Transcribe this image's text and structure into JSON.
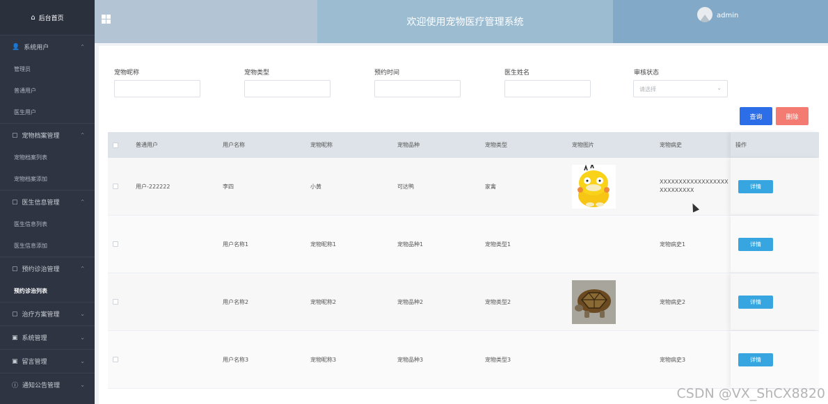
{
  "sidebar": {
    "home": "后台首页",
    "groups": [
      {
        "label": "系统用户",
        "items": [
          "管理员",
          "普通用户",
          "医生用户"
        ]
      },
      {
        "label": "宠物档案管理",
        "items": [
          "宠物档案列表",
          "宠物档案添加"
        ]
      },
      {
        "label": "医生信息管理",
        "items": [
          "医生信息列表",
          "医生信息添加"
        ]
      },
      {
        "label": "预约诊治管理",
        "items": [
          "预约诊治列表"
        ]
      },
      {
        "label": "治疗方案管理",
        "items": []
      },
      {
        "label": "系统管理",
        "items": []
      },
      {
        "label": "留言管理",
        "items": []
      },
      {
        "label": "通知公告管理",
        "items": []
      }
    ]
  },
  "header": {
    "title": "欢迎使用宠物医疗管理系统",
    "user": "admin"
  },
  "filters": {
    "pet_nickname": "宠物昵称",
    "pet_type": "宠物类型",
    "appointment_time": "预约时间",
    "doctor_name": "医生姓名",
    "review_status": "审核状态",
    "review_placeholder": "请选择"
  },
  "buttons": {
    "query": "查询",
    "delete": "删除"
  },
  "table": {
    "headers": [
      "普通用户",
      "用户名称",
      "宠物昵称",
      "宠物品种",
      "宠物类型",
      "宠物图片",
      "宠物病史",
      "操作"
    ],
    "detail_label": "详情",
    "rows": [
      {
        "user": "用户-222222",
        "name": "李四",
        "nickname": "小黄",
        "breed": "可达鸭",
        "type": "家禽",
        "image": "duck",
        "history": "XXXXXXXXXXXXXXXXXXXXXXXXXXX"
      },
      {
        "user": "",
        "name": "用户名称1",
        "nickname": "宠物昵称1",
        "breed": "宠物品种1",
        "type": "宠物类型1",
        "image": "",
        "history": "宠物病史1"
      },
      {
        "user": "",
        "name": "用户名称2",
        "nickname": "宠物昵称2",
        "breed": "宠物品种2",
        "type": "宠物类型2",
        "image": "tortoise",
        "history": "宠物病史2"
      },
      {
        "user": "",
        "name": "用户名称3",
        "nickname": "宠物昵称3",
        "breed": "宠物品种3",
        "type": "宠物类型3",
        "image": "",
        "history": "宠物病史3"
      }
    ]
  },
  "watermark": "CSDN @VX_ShCX8820"
}
